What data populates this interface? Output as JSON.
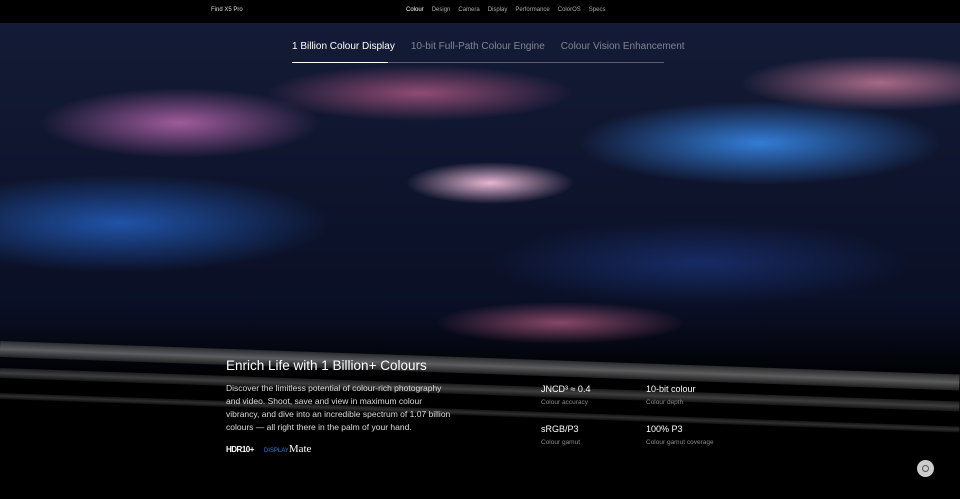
{
  "nav": {
    "brand": "Find X5 Pro",
    "links": [
      "Colour",
      "Design",
      "Camera",
      "Display",
      "Performance",
      "ColorOS",
      "Specs"
    ]
  },
  "tabs": [
    "1 Billion Colour Display",
    "10-bit Full-Path Colour Engine",
    "Colour Vision Enhancement"
  ],
  "section": {
    "title": "Enrich Life with 1 Billion+ Colours",
    "description": "Discover the limitless potential of colour-rich photography and video. Shoot, save and view in maximum colour vibrancy, and dive into an incredible spectrum of 1.07 billion colours — all right there in the palm of your hand.",
    "logos": [
      "HDR10+",
      "DISPLAYMate"
    ]
  },
  "stats": [
    {
      "value": "JNCD³ ≈ 0.4",
      "label": "Colour accuracy"
    },
    {
      "value": "10-bit colour",
      "label": "Colour depth"
    },
    {
      "value": "sRGB/P3",
      "label": "Colour gamut"
    },
    {
      "value": "100% P3",
      "label": "Colour gamut coverage"
    }
  ]
}
